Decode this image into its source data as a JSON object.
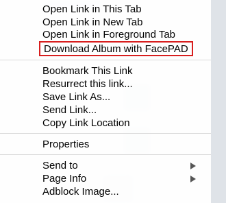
{
  "menu": {
    "open_group": [
      "Open Link in This Tab",
      "Open Link in New Tab",
      "Open Link in Foreground Tab"
    ],
    "highlighted_item": "Download Album with FacePAD",
    "link_group": [
      "Bookmark This Link",
      "Resurrect this link...",
      "Save Link As...",
      "Send Link...",
      "Copy Link Location"
    ],
    "properties": "Properties",
    "submenu_group": [
      {
        "label": "Send to",
        "icon": "submenu-arrow-icon"
      },
      {
        "label": "Page Info",
        "icon": "submenu-arrow-icon"
      },
      {
        "label": "Adblock Image...",
        "icon": ""
      }
    ]
  },
  "colors": {
    "highlight_border": "#d81e1e",
    "menu_background": "#ffffff",
    "separator": "#d9d9d9"
  }
}
